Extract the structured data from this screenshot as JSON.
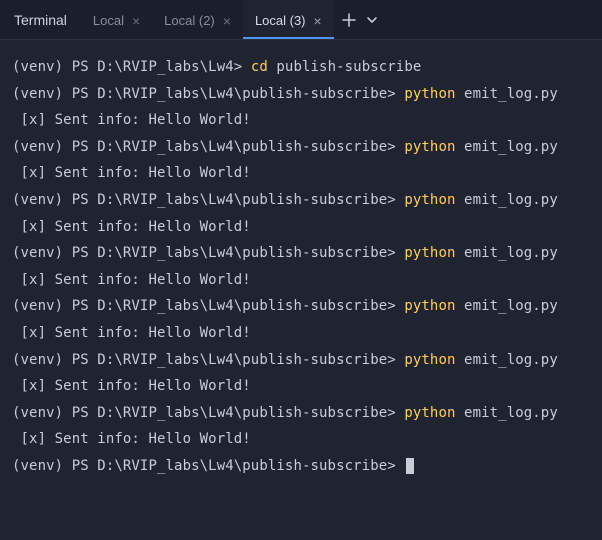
{
  "panelLabel": "Terminal",
  "tabs": [
    {
      "label": "Local",
      "active": false
    },
    {
      "label": "Local (2)",
      "active": false
    },
    {
      "label": "Local (3)",
      "active": true
    }
  ],
  "session": {
    "prompt1": "(venv) PS D:\\RVIP_labs\\Lw4> ",
    "cmd_cd": "cd",
    "cd_arg": " publish-subscribe",
    "prompt2": "(venv) PS D:\\RVIP_labs\\Lw4\\publish-subscribe> ",
    "cmd_py": "python",
    "py_arg": " emit_log.py",
    "output": " [x] Sent info: Hello World!"
  }
}
